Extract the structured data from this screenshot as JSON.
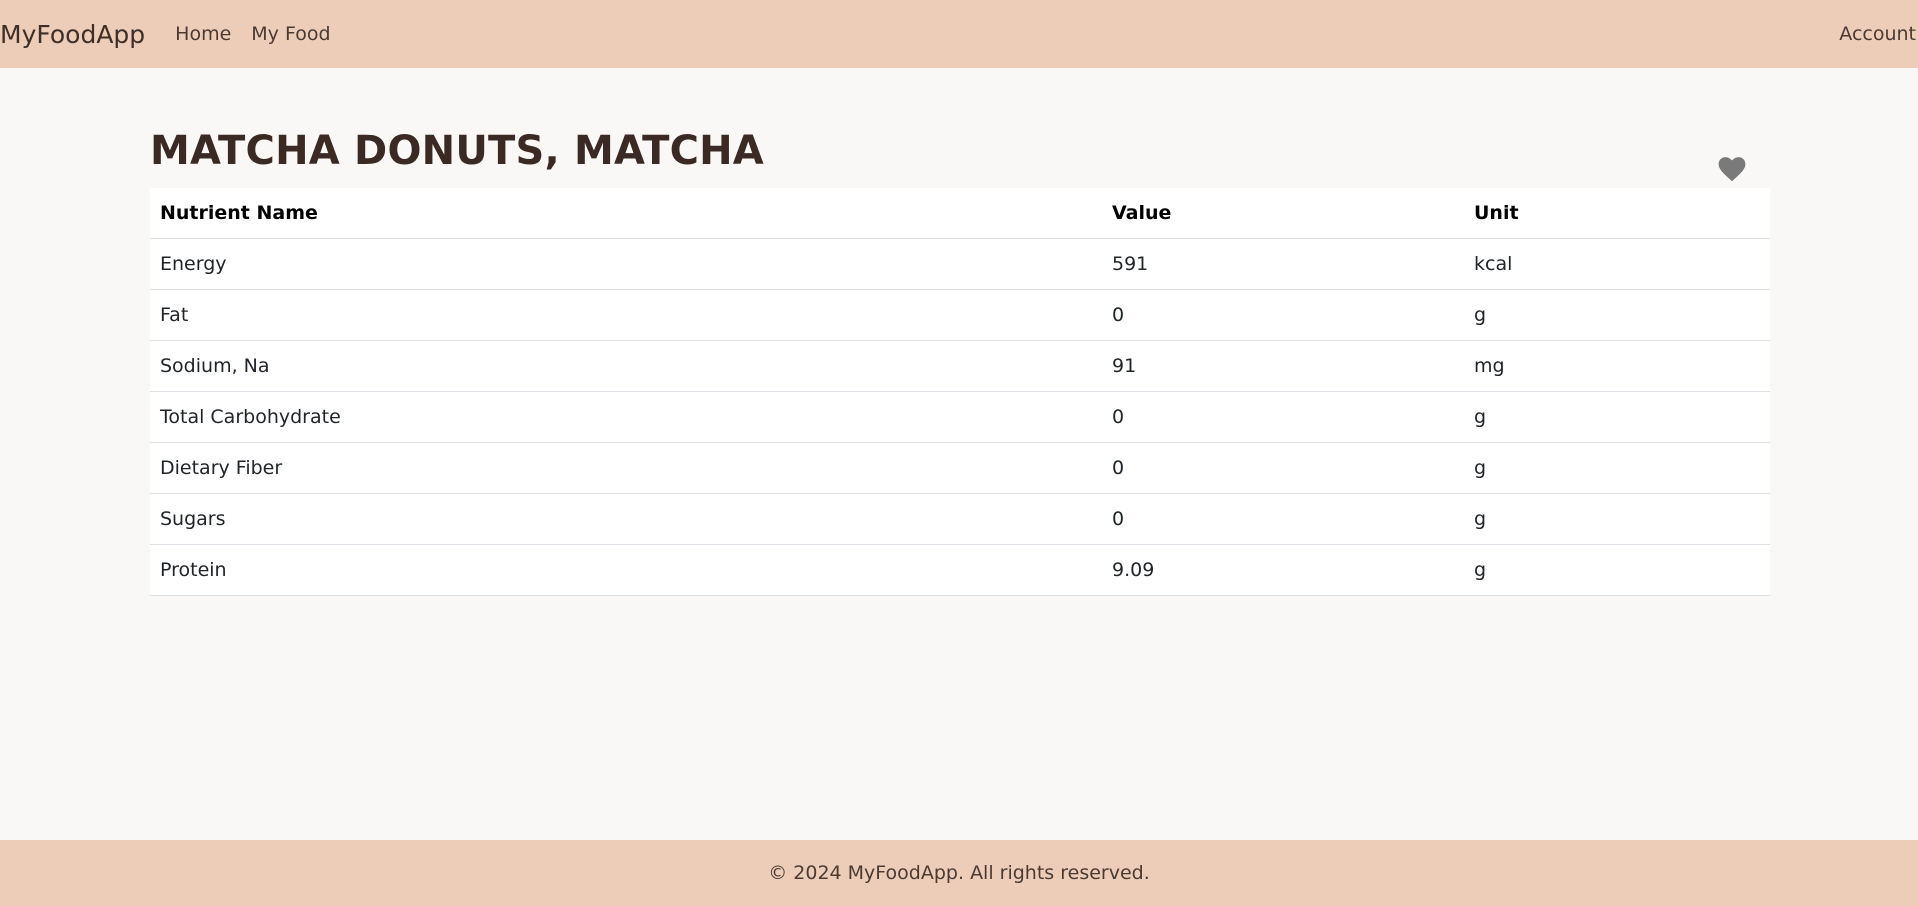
{
  "nav": {
    "brand": "MyFoodApp",
    "links": [
      "Home",
      "My Food"
    ],
    "account": "Account"
  },
  "food": {
    "title": "MATCHA DONUTS, MATCHA",
    "favorite_icon": "heart-icon"
  },
  "table": {
    "headers": [
      "Nutrient Name",
      "Value",
      "Unit"
    ],
    "rows": [
      {
        "name": "Energy",
        "value": "591",
        "unit": "kcal"
      },
      {
        "name": "Fat",
        "value": "0",
        "unit": "g"
      },
      {
        "name": "Sodium, Na",
        "value": "91",
        "unit": "mg"
      },
      {
        "name": "Total Carbohydrate",
        "value": "0",
        "unit": "g"
      },
      {
        "name": "Dietary Fiber",
        "value": "0",
        "unit": "g"
      },
      {
        "name": "Sugars",
        "value": "0",
        "unit": "g"
      },
      {
        "name": "Protein",
        "value": "9.09",
        "unit": "g"
      }
    ]
  },
  "footer": {
    "text": "© 2024 MyFoodApp. All rights reserved."
  },
  "colors": {
    "nav_bg": "#eecdb8",
    "page_bg": "#faf8f6",
    "heart": "#7a7a7a"
  }
}
